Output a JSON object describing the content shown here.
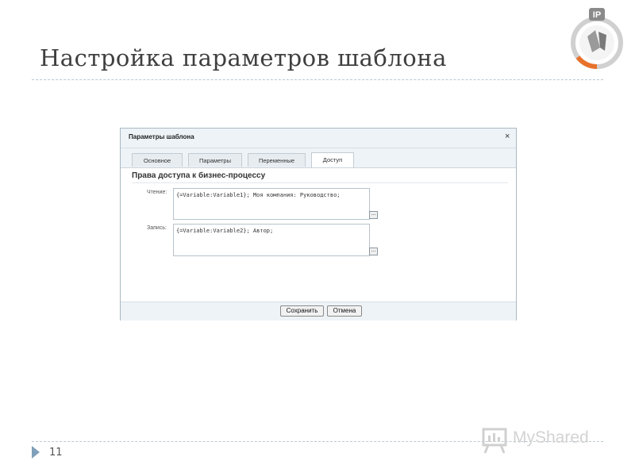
{
  "slide": {
    "title": "Настройка параметров шаблона",
    "page_number": "11",
    "watermark": "MyShared"
  },
  "logo": {
    "badge": "IP",
    "accent_color": "#e8722b",
    "ring_color": "#c9c9c9"
  },
  "dialog": {
    "title": "Параметры шаблона",
    "close_label": "×",
    "tabs": [
      {
        "label": "Основное",
        "active": false
      },
      {
        "label": "Параметры",
        "active": false
      },
      {
        "label": "Переменные",
        "active": false
      },
      {
        "label": "Доступ",
        "active": true
      }
    ],
    "section_title": "Права доступа к бизнес-процессу",
    "fields": [
      {
        "label": "Чтение:",
        "value": "{=Variable:Variable1}; Моя компания: Руководство;",
        "dots": "..."
      },
      {
        "label": "Запись:",
        "value": "{=Variable:Variable2}; Автор;",
        "dots": "..."
      }
    ],
    "buttons": {
      "save": "Сохранить",
      "cancel": "Отмена"
    }
  }
}
